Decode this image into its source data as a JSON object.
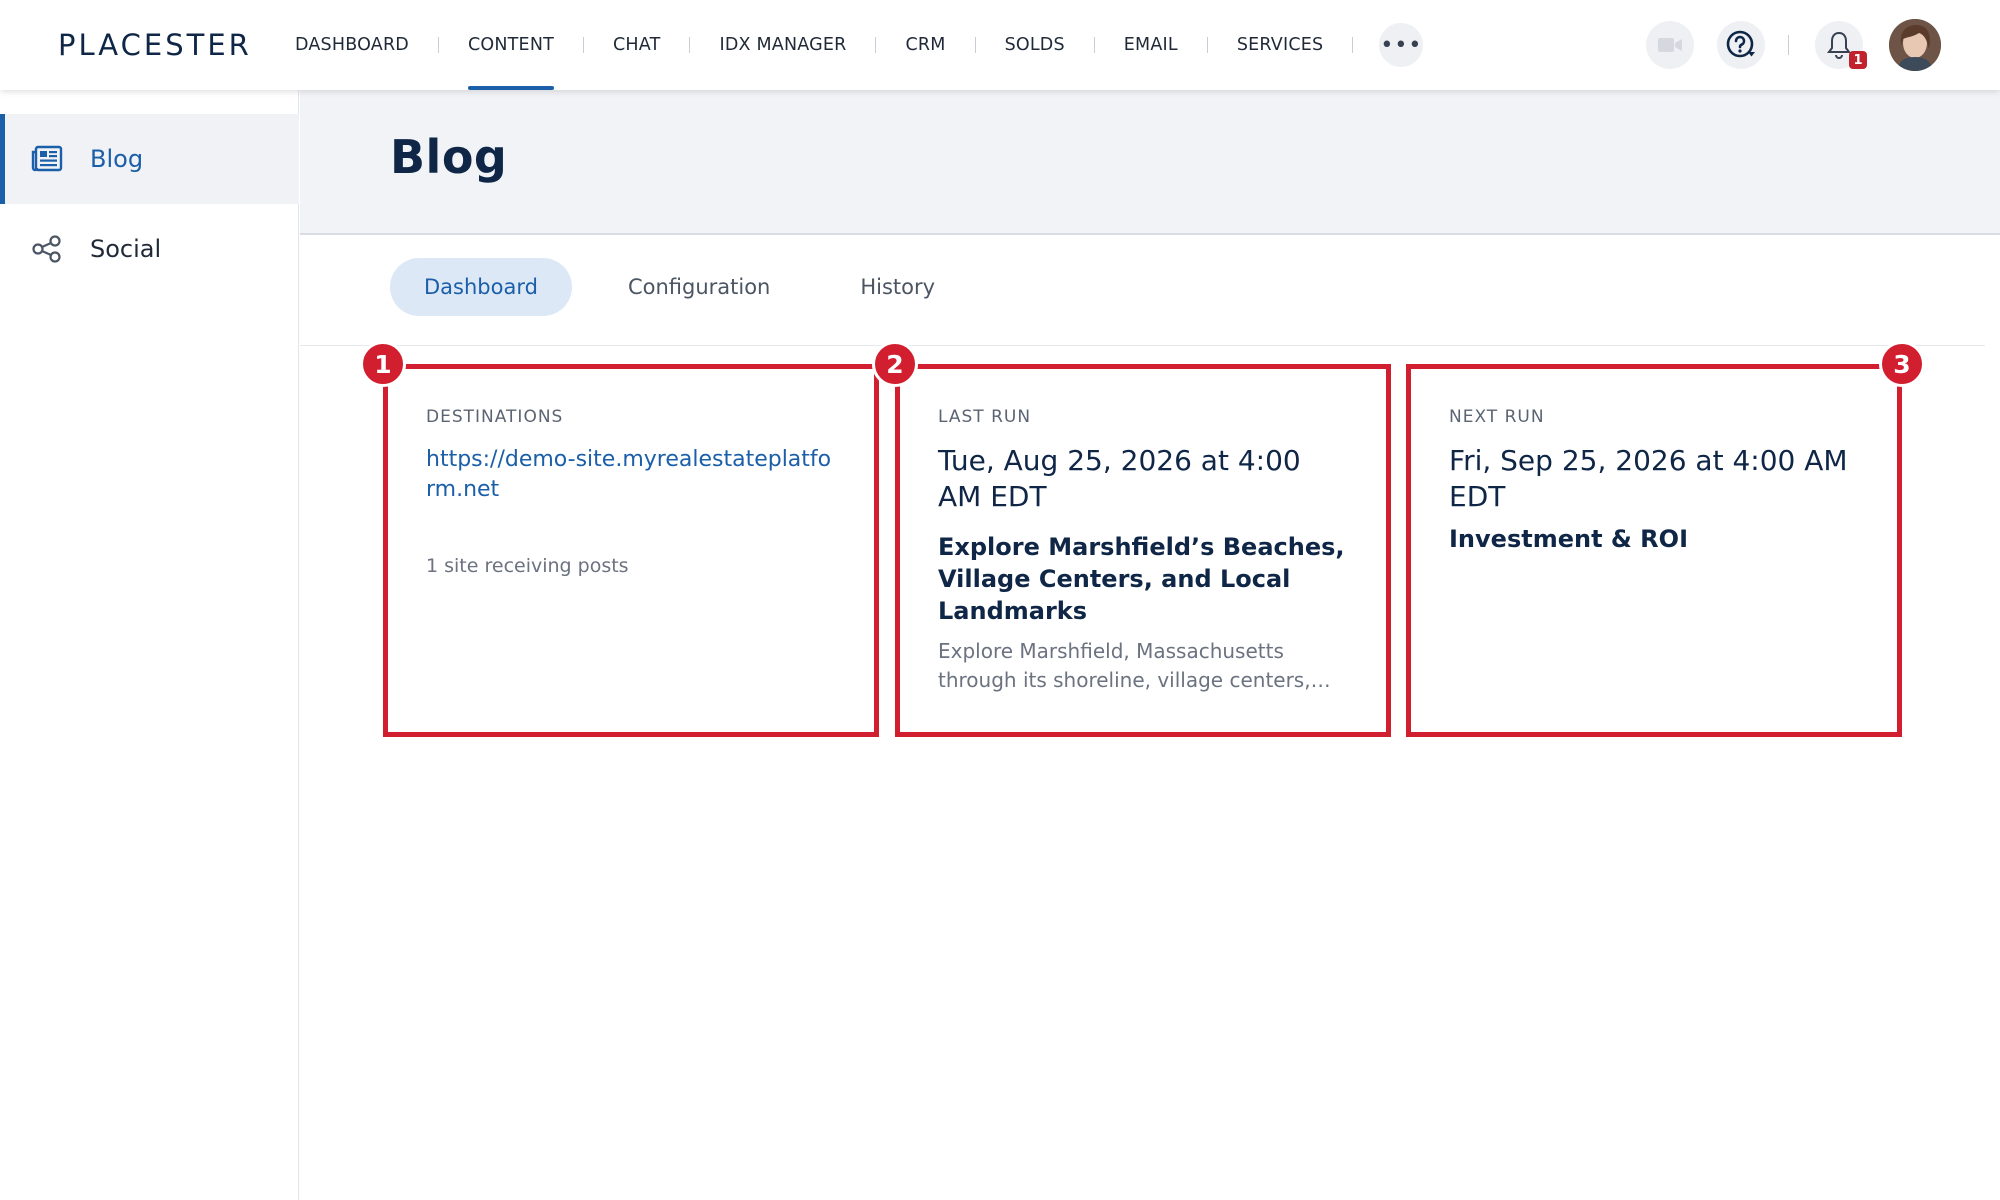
{
  "brand": {
    "name": "PLACESTER"
  },
  "nav": {
    "items": [
      "DASHBOARD",
      "CONTENT",
      "CHAT",
      "IDX MANAGER",
      "CRM",
      "SOLDS",
      "EMAIL",
      "SERVICES"
    ],
    "active_index": 1,
    "more_label": "•••",
    "notification_count": "1"
  },
  "sidebar": {
    "items": [
      {
        "label": "Blog",
        "icon": "newspaper-icon"
      },
      {
        "label": "Social",
        "icon": "share-icon"
      }
    ],
    "active_index": 0
  },
  "page": {
    "title": "Blog",
    "tabs": [
      "Dashboard",
      "Configuration",
      "History"
    ],
    "active_tab": 0
  },
  "cards": {
    "destinations": {
      "number": "1",
      "label": "DESTINATIONS",
      "link": "https://demo-site.myrealestateplatform.net",
      "subtext": "1 site receiving posts"
    },
    "last_run": {
      "number": "2",
      "label": "LAST RUN",
      "date": "Tue, Aug 25, 2026 at 4:00 AM EDT",
      "post_title": "Explore Marshfield’s Beaches, Village Centers, and Local Landmarks",
      "excerpt": "Explore Marshfield, Massachusetts through its shoreline, village centers, and local landmarks"
    },
    "next_run": {
      "number": "3",
      "label": "NEXT RUN",
      "date": "Fri, Sep 25, 2026 at 4:00 AM EDT",
      "post_title": "Investment & ROI"
    }
  },
  "colors": {
    "brand_blue": "#1a5fa8",
    "navy": "#0f2647",
    "highlight_red": "#d21f30"
  }
}
